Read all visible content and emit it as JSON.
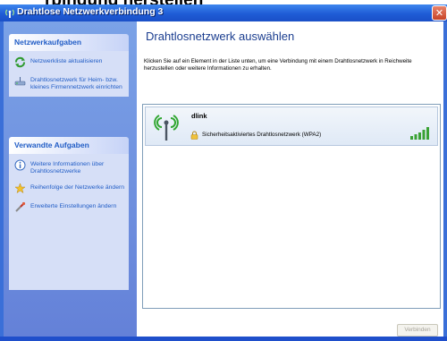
{
  "page": {
    "heading": "rbindung herstellen"
  },
  "window": {
    "title": "Drahtlose Netzwerkverbindung 3",
    "close_symbol": "✕"
  },
  "sidebar": {
    "network_tasks": {
      "header": "Netzwerkaufgaben",
      "items": [
        {
          "icon": "refresh-icon",
          "label": "Netzwerkliste aktualisieren"
        },
        {
          "icon": "wireless-setup-icon",
          "label": "Drahtlosnetzwerk für Heim- bzw. kleines Firmennetzwerk einrichten"
        }
      ]
    },
    "related_tasks": {
      "header": "Verwandte Aufgaben",
      "items": [
        {
          "icon": "info-icon",
          "label": "Weitere Informationen über Drahtlosnetzwerke"
        },
        {
          "icon": "star-icon",
          "label": "Reihenfolge der Netzwerke ändern"
        },
        {
          "icon": "settings-icon",
          "label": "Erweiterte Einstellungen ändern"
        }
      ]
    }
  },
  "content": {
    "title": "Drahtlosnetzwerk auswählen",
    "instructions": "Klicken Sie auf ein Element in der Liste unten, um eine Verbindung mit einem Drahtlosnetzwerk in Reichweite herzustellen oder weitere Informationen zu erhalten.",
    "networks": [
      {
        "name": "dlink",
        "security": "Sicherheitsaktiviertes Drahtlosnetzwerk (WPA2)",
        "signal_strength": 1.0
      }
    ],
    "connect_button": "Verbinden"
  },
  "colors": {
    "titlebar": "#1f5cd6",
    "sidebar": "#6f94e0",
    "task_header_text": "#215dc6",
    "link_text": "#215dc6",
    "content_title": "#1a3d8f",
    "signal_green": "#3aa234"
  }
}
